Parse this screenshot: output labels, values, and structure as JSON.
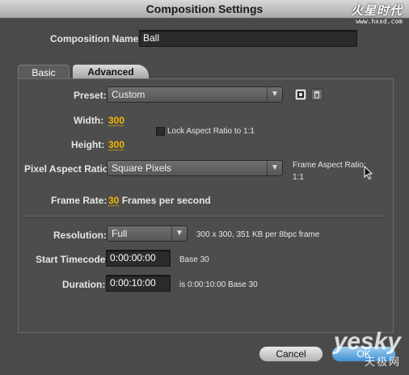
{
  "window": {
    "title": "Composition Settings"
  },
  "watermark_top": {
    "brand": "火星时代",
    "site": "www.hxsd.com"
  },
  "composition_name": {
    "label": "Composition Name:",
    "value": "Ball"
  },
  "tabs": [
    {
      "label": "Basic"
    },
    {
      "label": "Advanced"
    }
  ],
  "basic": {
    "preset": {
      "label": "Preset:",
      "value": "Custom"
    },
    "width": {
      "label": "Width:",
      "value": "300"
    },
    "height": {
      "label": "Height:",
      "value": "300"
    },
    "lock_aspect": {
      "label": "Lock Aspect Ratio to 1:1",
      "checked": false
    },
    "pixel_aspect": {
      "label": "Pixel Aspect Ratio:",
      "value": "Square Pixels"
    },
    "frame_aspect": {
      "label": "Frame Aspect Ratio:",
      "value": "1:1"
    },
    "frame_rate": {
      "label": "Frame Rate:",
      "value": "30",
      "unit": "Frames per second"
    },
    "resolution": {
      "label": "Resolution:",
      "value": "Full",
      "info": "300 x 300, 351 KB per 8bpc frame"
    },
    "start_timecode": {
      "label": "Start Timecode:",
      "value": "0:00:00:00",
      "base": "Base 30"
    },
    "duration": {
      "label": "Duration:",
      "value": "0:00:10:00",
      "info": "is 0:00:10:00  Base 30"
    }
  },
  "buttons": {
    "cancel": "Cancel",
    "ok": "OK"
  },
  "watermark_bottom": {
    "logo": "yesky",
    "cn": "天极网"
  },
  "colors": {
    "accent_value": "#f2b700",
    "background": "#4a4a4a",
    "ok_blue": "#3f90d2"
  }
}
